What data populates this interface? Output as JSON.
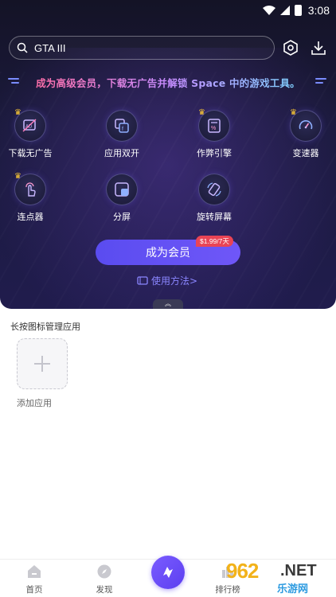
{
  "status_bar": {
    "time": "3:08"
  },
  "search": {
    "value": "GTA III"
  },
  "banner": {
    "text": "成为高级会员，下载无广告并解锁 Space 中的游戏工具。"
  },
  "features": [
    {
      "label": "下载无广告",
      "icon": "ad-block-icon",
      "vip": true
    },
    {
      "label": "应用双开",
      "icon": "dual-app-icon",
      "vip": false
    },
    {
      "label": "作弊引擎",
      "icon": "cheat-engine-icon",
      "vip": true
    },
    {
      "label": "变速器",
      "icon": "speedometer-icon",
      "vip": true
    },
    {
      "label": "连点器",
      "icon": "auto-clicker-icon",
      "vip": true
    },
    {
      "label": "分屏",
      "icon": "split-screen-icon",
      "vip": false
    },
    {
      "label": "旋转屏幕",
      "icon": "rotate-screen-icon",
      "vip": false
    }
  ],
  "vip": {
    "button_label": "成为会员",
    "price_tag": "$1.99/7天"
  },
  "usage": {
    "label": "使用方法>"
  },
  "apps": {
    "section_title": "长按图标管理应用",
    "add_label": "添加应用"
  },
  "nav": {
    "home": "首页",
    "discover": "发现",
    "rank": "排行榜"
  },
  "watermark": {
    "number": "962",
    "net": ".NET",
    "cn": "乐游网"
  },
  "colors": {
    "accent": "#5a4cf0",
    "price_tag": "#e94455",
    "usage_link": "#8a86ff"
  }
}
